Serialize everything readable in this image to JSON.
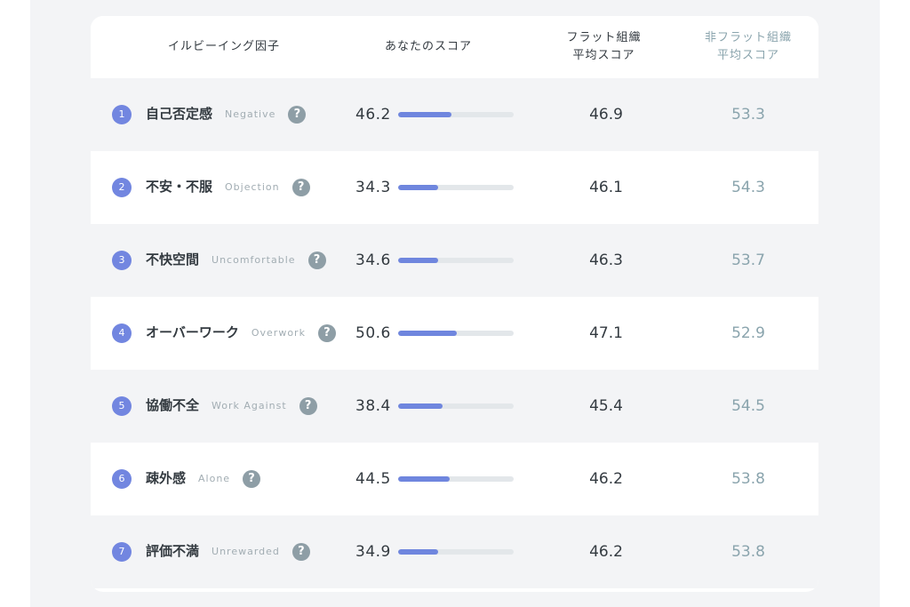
{
  "header": {
    "factor": "イルビーイング因子",
    "your_score": "あなたのスコア",
    "flat_line1": "フラット組織",
    "flat_line2": "平均スコア",
    "nonflat_line1": "非フラット組織",
    "nonflat_line2": "平均スコア"
  },
  "help_glyph": "?",
  "colors": {
    "accent": "#7286e0",
    "bar_fill": "#6f86de",
    "bar_track": "#e3e7ea",
    "nonflat_text": "#8aa4ad",
    "help_icon": "#8e9ea6"
  },
  "rows": [
    {
      "number": "1",
      "name": "自己否定感",
      "english": "Negative",
      "score": "46.2",
      "bar_fraction": 0.462,
      "flat": "46.9",
      "nonflat": "53.3"
    },
    {
      "number": "2",
      "name": "不安・不服",
      "english": "Objection",
      "score": "34.3",
      "bar_fraction": 0.343,
      "flat": "46.1",
      "nonflat": "54.3"
    },
    {
      "number": "3",
      "name": "不快空間",
      "english": "Uncomfortable",
      "score": "34.6",
      "bar_fraction": 0.346,
      "flat": "46.3",
      "nonflat": "53.7"
    },
    {
      "number": "4",
      "name": "オーバーワーク",
      "english": "Overwork",
      "score": "50.6",
      "bar_fraction": 0.506,
      "flat": "47.1",
      "nonflat": "52.9"
    },
    {
      "number": "5",
      "name": "協働不全",
      "english": "Work Against",
      "score": "38.4",
      "bar_fraction": 0.384,
      "flat": "45.4",
      "nonflat": "54.5"
    },
    {
      "number": "6",
      "name": "疎外感",
      "english": "Alone",
      "score": "44.5",
      "bar_fraction": 0.445,
      "flat": "46.2",
      "nonflat": "53.8"
    },
    {
      "number": "7",
      "name": "評価不満",
      "english": "Unrewarded",
      "score": "34.9",
      "bar_fraction": 0.349,
      "flat": "46.2",
      "nonflat": "53.8"
    }
  ]
}
